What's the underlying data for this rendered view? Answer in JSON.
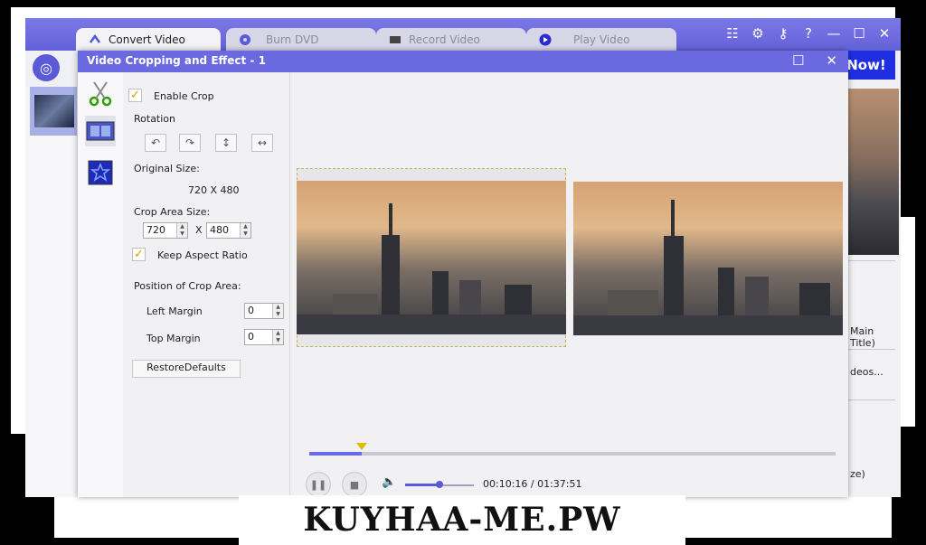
{
  "tabs": [
    {
      "label": "Convert Video",
      "icon": "convert-icon",
      "active": true
    },
    {
      "label": "Burn DVD",
      "icon": "disc-icon",
      "active": false
    },
    {
      "label": "Record Video",
      "icon": "record-icon",
      "active": false
    },
    {
      "label": "Play Video",
      "icon": "play-icon",
      "active": false
    }
  ],
  "window_controls": {
    "report": "☷",
    "settings": "⚙",
    "key": "⚷",
    "help": "?",
    "minimize": "—",
    "maximize": "☐",
    "close": "✕"
  },
  "convert_now_label": "Now!",
  "dialog": {
    "title": "Video Cropping and Effect - 1",
    "maximize": "☐",
    "close": "✕"
  },
  "settings": {
    "enable_crop": "Enable Crop",
    "rotation": "Rotation",
    "original_size_label": "Original Size:",
    "original_size_value": "720 X 480",
    "crop_area_label": "Crop Area Size:",
    "crop_width": "720",
    "crop_x": "X",
    "crop_height": "480",
    "keep_aspect": "Keep Aspect Ratio",
    "position_label": "Position of Crop Area:",
    "left_margin_label": "Left Margin",
    "left_margin_value": "0",
    "top_margin_label": "Top Margin",
    "top_margin_value": "0",
    "restore": "RestoreDefaults"
  },
  "player": {
    "time": "00:10:16 / 01:37:51",
    "progress_fraction": 0.1,
    "volume_fraction": 0.5
  },
  "right_panel": {
    "main_title": "Main Title)",
    "videos": "deos...",
    "ze": "ze)"
  },
  "banner": "KUYHAA-ME.PW",
  "colors": {
    "accent": "#6b69e0",
    "button_blue": "#1f2ee0"
  }
}
